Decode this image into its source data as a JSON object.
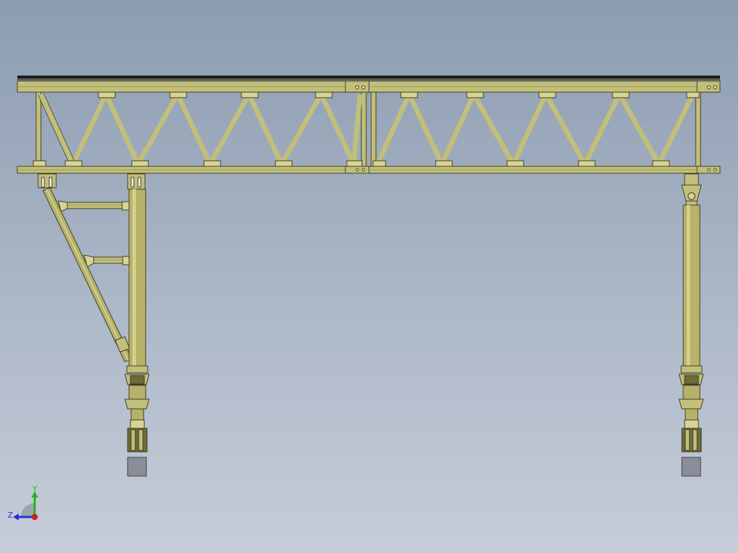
{
  "viewport": {
    "background_top": "#8d9cb0",
    "background_bottom": "#c7cdd8"
  },
  "model": {
    "members": "Truss",
    "member_color": "#c2bf7a",
    "member_dark": "#9c9858",
    "column_color": "#b6b26a",
    "rail_color": "#1c1c1c",
    "footing_color": "#8a8e98",
    "trusses": 2,
    "columns": 2
  },
  "triad": {
    "y_label": "Y",
    "z_label": "Z",
    "y_color": "#1fb51f",
    "z_color": "#1f2fd0",
    "origin_color": "#d01f1f"
  }
}
